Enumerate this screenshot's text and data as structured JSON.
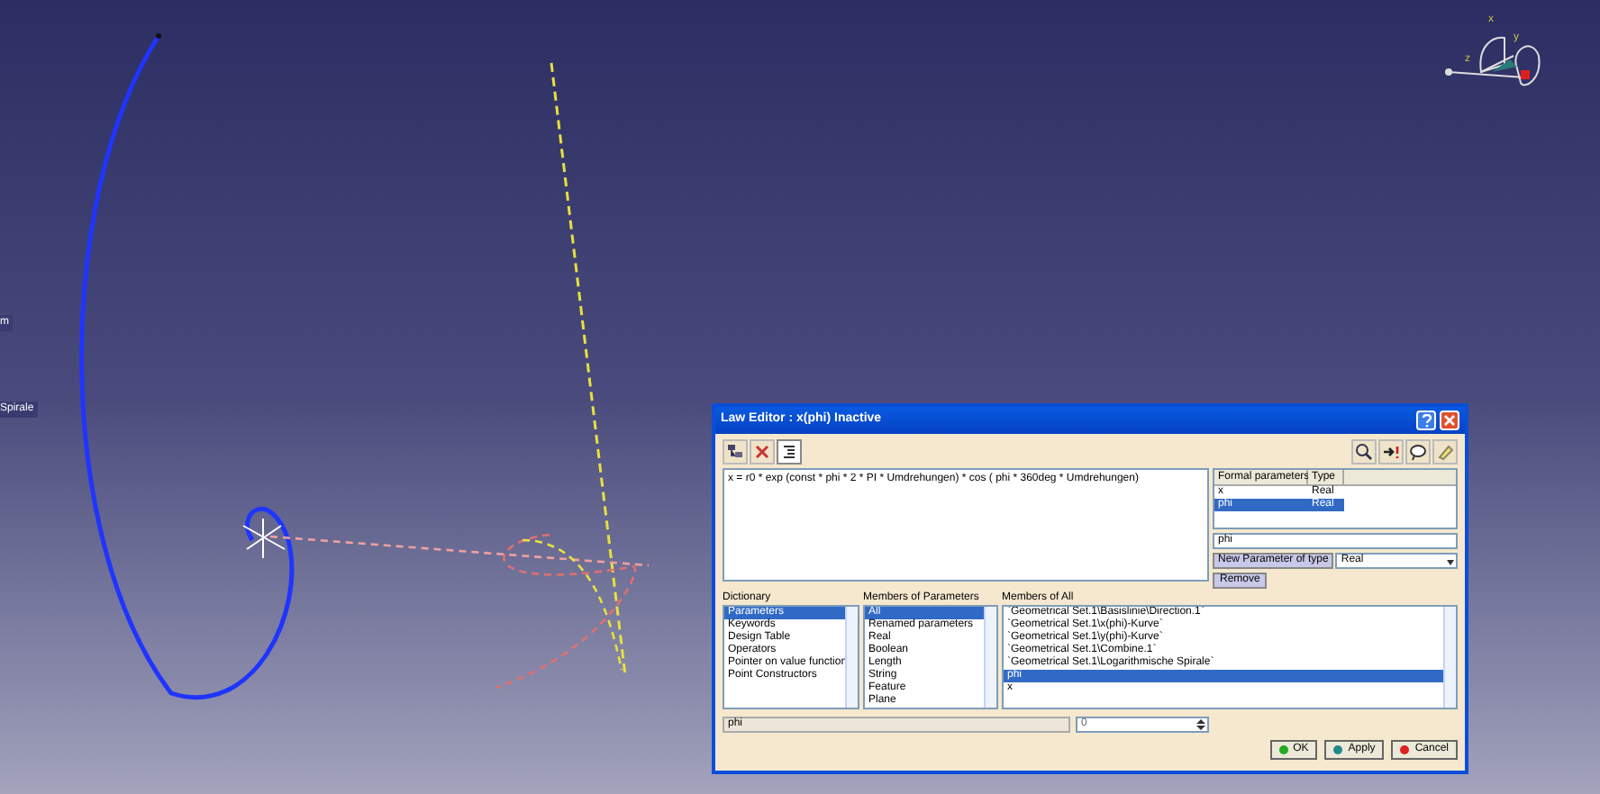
{
  "viewport_labels": [
    {
      "text": "m"
    },
    {
      "text": "Spirale"
    }
  ],
  "compass_axes": [
    "x",
    "y",
    "z"
  ],
  "dialog": {
    "title": "Law Editor : x(phi) Inactive",
    "formula": "x = r0 * exp (const * phi * 2 * PI * Umdrehungen) * cos ( phi * 360deg * Umdrehungen)",
    "formal_parameters": {
      "columns": [
        "Formal parameters",
        "Type"
      ],
      "rows": [
        {
          "name": "x",
          "type": "Real",
          "selected": false
        },
        {
          "name": "phi",
          "type": "Real",
          "selected": true
        }
      ]
    },
    "parameter_name": "phi",
    "new_parameter_button": "New Parameter of type",
    "new_parameter_type": "Real",
    "remove_button": "Remove",
    "dictionary": {
      "label": "Dictionary",
      "items": [
        {
          "text": "Parameters",
          "selected": true
        },
        {
          "text": "Keywords",
          "selected": false
        },
        {
          "text": "Design Table",
          "selected": false
        },
        {
          "text": "Operators",
          "selected": false
        },
        {
          "text": "Pointer on value function",
          "selected": false
        },
        {
          "text": "Point Constructors",
          "selected": false
        }
      ]
    },
    "members_of_parameters": {
      "label": "Members of Parameters",
      "items": [
        {
          "text": "All",
          "selected": true
        },
        {
          "text": "Renamed parameters",
          "selected": false
        },
        {
          "text": "Real",
          "selected": false
        },
        {
          "text": "Boolean",
          "selected": false
        },
        {
          "text": "Length",
          "selected": false
        },
        {
          "text": "String",
          "selected": false
        },
        {
          "text": "Feature",
          "selected": false
        },
        {
          "text": "Plane",
          "selected": false
        }
      ]
    },
    "members_of_all": {
      "label": "Members of All",
      "items": [
        {
          "text": "`Geometrical Set.1\\Basislinie\\Direction.1`",
          "selected": false
        },
        {
          "text": "`Geometrical Set.1\\x(phi)-Kurve`",
          "selected": false
        },
        {
          "text": "`Geometrical Set.1\\y(phi)-Kurve`",
          "selected": false
        },
        {
          "text": "`Geometrical Set.1\\Combine.1`",
          "selected": false
        },
        {
          "text": "`Geometrical Set.1\\Logarithmische Spirale`",
          "selected": false
        },
        {
          "text": "phi",
          "selected": true
        },
        {
          "text": "x",
          "selected": false
        }
      ]
    },
    "selected_name": "phi",
    "value": "0",
    "buttons": [
      {
        "label": "OK",
        "color": "#22aa22"
      },
      {
        "label": "Apply",
        "color": "#228888"
      },
      {
        "label": "Cancel",
        "color": "#dd2222"
      }
    ]
  }
}
